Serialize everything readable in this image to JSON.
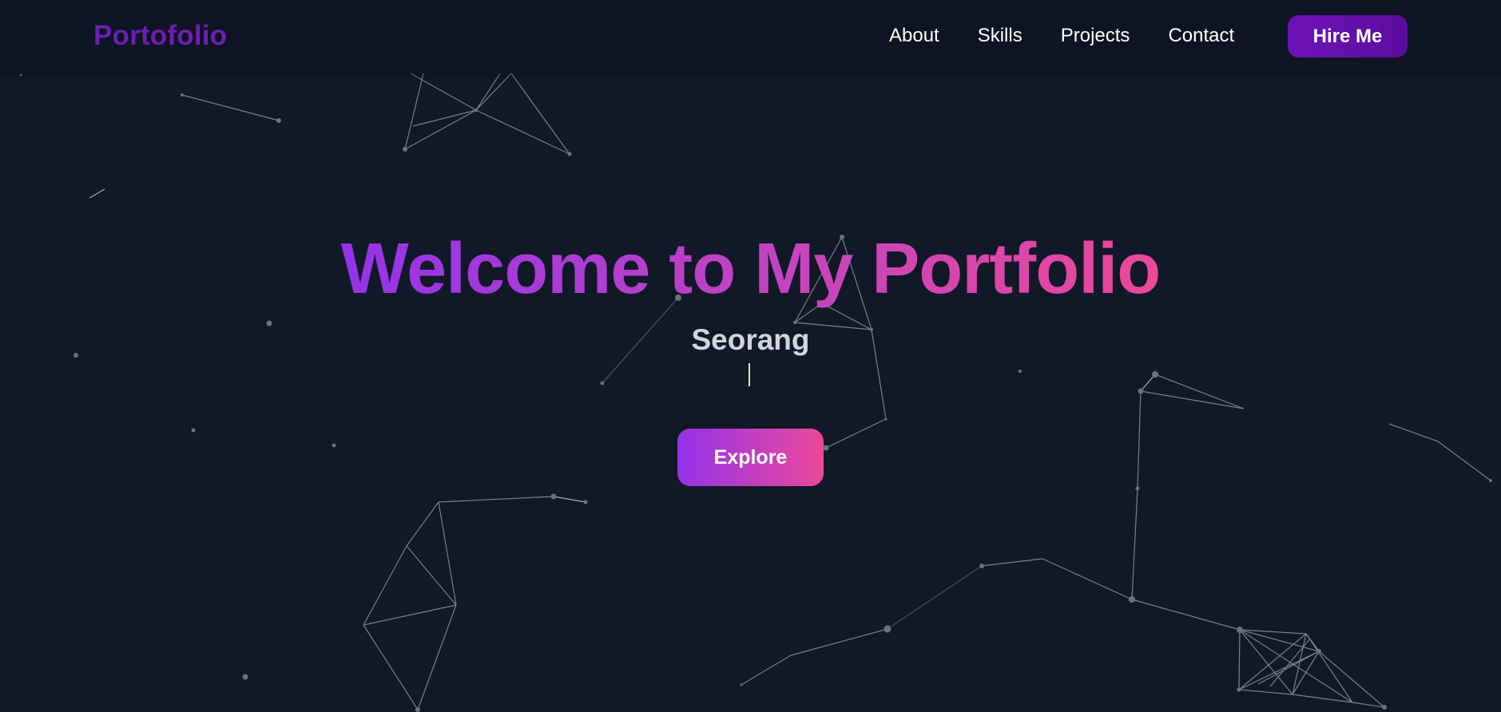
{
  "navbar": {
    "logo": "Portofolio",
    "links": [
      "About",
      "Skills",
      "Projects",
      "Contact"
    ],
    "cta_label": "Hire Me"
  },
  "hero": {
    "title": "Welcome to My Portfolio",
    "name": "Seorang",
    "button_label": "Explore"
  },
  "colors": {
    "background": "#111827",
    "logo": "#6d1fb3",
    "gradient_start": "#9333ea",
    "gradient_end": "#ec4899",
    "hire_button": "#6d12b8"
  }
}
